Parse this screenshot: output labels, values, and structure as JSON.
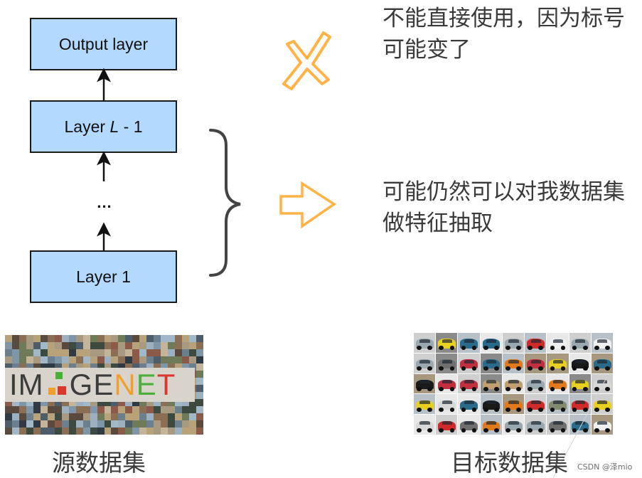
{
  "diagram": {
    "layers": {
      "output": "Output layer",
      "second_to_last_prefix": "Layer ",
      "second_to_last_var": "L",
      "second_to_last_suffix": " - 1",
      "first": "Layer 1"
    },
    "ellipsis": "..."
  },
  "annotations": {
    "top_note": "不能直接使用，因为标号可能变了",
    "top_icon": "cross-icon",
    "mid_note": "可能仍然可以对我数据集做特征抽取",
    "mid_icon": "right-arrow-icon",
    "brace_icon": "right-curly-brace-icon"
  },
  "images": {
    "source_logo_text": {
      "parts": [
        "IM",
        "A",
        "GE",
        "N",
        "E",
        "T"
      ]
    }
  },
  "captions": {
    "source": "源数据集",
    "target": "目标数据集"
  },
  "watermark": "CSDN @泽mio",
  "colors": {
    "layer_fill": "#b3d9ff",
    "layer_border": "#1a1a1a",
    "accent_orange": "#ffb347",
    "brace": "#444444",
    "text": "#3a3a3a",
    "imagenet_n": "#f0a030",
    "imagenet_e": "#4caf3a",
    "imagenet_t": "#d9382e"
  }
}
